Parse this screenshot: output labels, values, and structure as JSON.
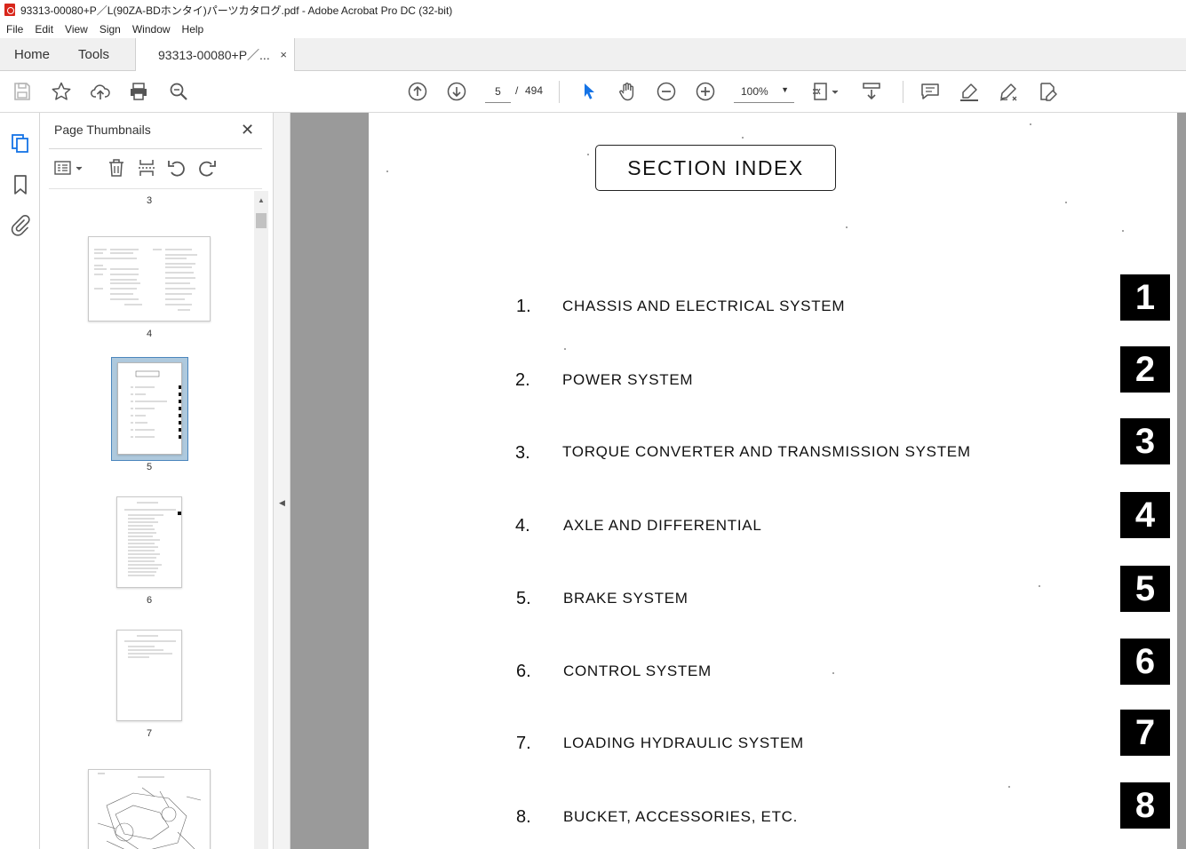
{
  "window": {
    "title": "93313-00080+P／L(90ZA-BDホンタイ)パーツカタログ.pdf - Adobe Acrobat Pro DC (32-bit)"
  },
  "menu": [
    "File",
    "Edit",
    "View",
    "Sign",
    "Window",
    "Help"
  ],
  "tabs": {
    "home": "Home",
    "tools": "Tools",
    "document": "93313-00080+P／...",
    "close": "×"
  },
  "toolbar": {
    "icons": [
      "save-icon",
      "bookmark-star-icon",
      "upload-cloud-icon",
      "print-icon",
      "zoom-search-icon",
      "prev-page-icon",
      "next-page-icon",
      "select-cursor-icon",
      "hand-pan-icon",
      "zoom-out-icon",
      "zoom-in-icon",
      "fit-page-icon",
      "scroll-mode-icon",
      "comment-icon",
      "highlight-icon",
      "sign-icon",
      "more-tools-icon"
    ],
    "page_current": "5",
    "page_separator": "/",
    "page_total": "494",
    "zoom": "100%",
    "zoom_caret": "▼"
  },
  "panel": {
    "title": "Page Thumbnails",
    "close": "✕",
    "thumbnails": [
      {
        "label": "3"
      },
      {
        "label": "4"
      },
      {
        "label": "5",
        "selected": true
      },
      {
        "label": "6"
      },
      {
        "label": "7"
      }
    ]
  },
  "document": {
    "heading": "SECTION  INDEX",
    "sections": [
      {
        "num": "1.",
        "label": "CHASSIS  AND  ELECTRICAL  SYSTEM",
        "tab": "1"
      },
      {
        "num": "2.",
        "label": "POWER  SYSTEM",
        "tab": "2"
      },
      {
        "num": "3.",
        "label": "TORQUE CONVERTER  AND  TRANSMISSION  SYSTEM",
        "tab": "3"
      },
      {
        "num": "4.",
        "label": "AXLE  AND  DIFFERENTIAL",
        "tab": "4"
      },
      {
        "num": "5.",
        "label": "BRAKE  SYSTEM",
        "tab": "5"
      },
      {
        "num": "6.",
        "label": "CONTROL  SYSTEM",
        "tab": "6"
      },
      {
        "num": "7.",
        "label": "LOADING  HYDRAULIC  SYSTEM",
        "tab": "7"
      },
      {
        "num": "8.",
        "label": "BUCKET,  ACCESSORIES,  ETC.",
        "tab": "8"
      }
    ]
  },
  "colors": {
    "selection_fill": "#aec9dd",
    "selection_border": "#4b86bd",
    "doc_background": "#9a9a9a",
    "pdf_red": "#d8261b"
  }
}
